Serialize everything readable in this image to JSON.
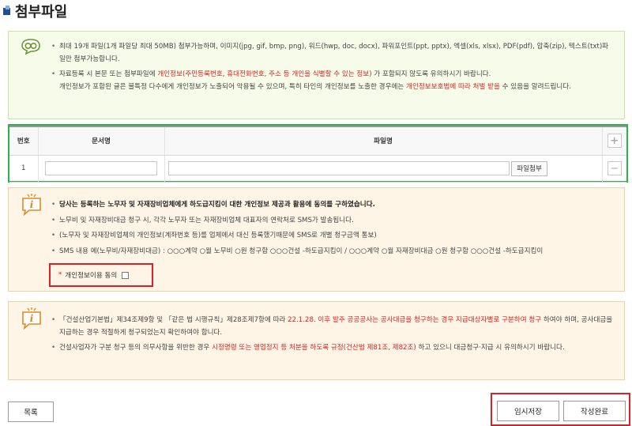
{
  "page_title": "첨부파일",
  "notice_top": {
    "bullet1": "최대 19개 파일(1개 파일당 최대 50MB) 첨부가능하며, 이미지(jpg, gif, bmp, png), 워드(hwp, doc, docx), 파워포인트(ppt, pptx), 엑셀(xls, xlsx), PDF(pdf), 압축(zip), 텍스트(txt)파일만 첨부가능합니다.",
    "bullet2_a": "자료등록 시 본문 또는 첨부파일에 ",
    "bullet2_red": "개인정보(주민등록번호, 휴대전화번호, 주소 등 개인을 식별할 수 있는 정보)",
    "bullet2_b": " 가 포함되지 않도록 유의하시기 바랍니다.",
    "bullet3_a": "개인정보가 포함된 글은 불특정 다수에게 개인정보가 노출되어 악용될 수 있으며, 특히 타인의 개인정보를 노출한 경우에는 ",
    "bullet3_red": "개인정보보호법에 따라 처벌 받을",
    "bullet3_b": " 수 있음을 알려드립니다."
  },
  "file_table": {
    "headers": {
      "num": "번호",
      "doc_name": "문서명",
      "file_name": "파일명"
    },
    "row_num": "1",
    "attach_label": "파일첨부",
    "add_symbol": "+",
    "remove_symbol": "−"
  },
  "notice_consent": {
    "heading": "당사는 등록하는 노무자 및 자재장비업체에게 하도급지킴이 대한 개인정보 제공과 활용에 동의를 구하였습니다.",
    "bullet1": "노무비 및 자재장비대금 청구 시, 각각 노무자 또는 자재장비업체 대표자의 연락처로 SMS가 발송됩니다.",
    "bullet2": "(노무자 및 자재장비업체의 개인정보(계좌번호 등)를 업체에서 대신 등록했기때문에 SMS로 개별 청구금액 통보)",
    "bullet3": "SMS 내용 예(노무비/자재장비대금) : ○○○계약 ○월 노무비 ○원 청구함 ○○○건설 -하도급지킴이 / ○○○계약 ○월 자재장비대금 ○원 청구함 ○○○건설 -하도급지킴이",
    "consent_star": "*",
    "consent_label": "개인정보이용 동의"
  },
  "notice_law": {
    "bullet1_a": "「건설산업기본법」제34조제9항 및 「같은 법 시행규칙」제28조제7항에 따라 ",
    "bullet1_red": "22.1.28. 이후 발주 공공공사는 공사대금을 청구하는 경우 지급대상자별로 구분하여 청구",
    "bullet1_b": " 하여야 하며, 공사대금을 지급하는 경우 적절하게 청구되었는지 확인하여야 합니다.",
    "bullet2_a": "건설사업자가 구분 청구 등의 의무사항을 위반한 경우 ",
    "bullet2_red": "시정명령 또는 영업정지 등 처분을 하도록 규정(건산법 제81조, 제82조)",
    "bullet2_b": " 하고 있으니 대금청구·지급 시 유의하시기 바랍니다."
  },
  "buttons": {
    "list": "목록",
    "temp_save": "임시저장",
    "complete": "작성완료"
  },
  "colors": {
    "accent_red": "#d9222a",
    "highlight_green": "#2bb34a",
    "notice_green_bg": "#f7fbe9",
    "notice_orange_bg": "#fff5e6"
  }
}
